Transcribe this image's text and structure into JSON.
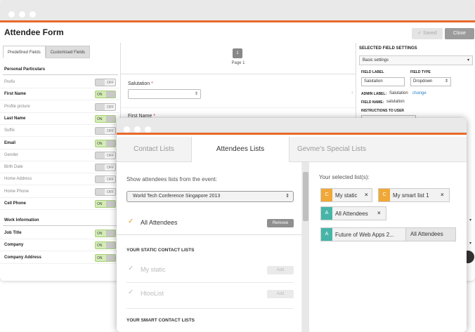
{
  "form": {
    "title": "Attendee Form",
    "saved_label": "✓ Saved",
    "close_label": "Close",
    "tabs": [
      "Predefined Fields",
      "Customised Fields"
    ],
    "section_personal": "Personal Particulars",
    "personal_fields": [
      {
        "label": "Prefix",
        "state": "OFF",
        "bold": false
      },
      {
        "label": "First Name",
        "state": "ON",
        "bold": true
      },
      {
        "label": "Profile picture",
        "state": "OFF",
        "bold": false
      },
      {
        "label": "Last Name",
        "state": "ON",
        "bold": true
      },
      {
        "label": "Suffix",
        "state": "OFF",
        "bold": false
      },
      {
        "label": "Email",
        "state": "ON",
        "bold": true
      },
      {
        "label": "Gender",
        "state": "OFF",
        "bold": false
      },
      {
        "label": "Birth Date",
        "state": "OFF",
        "bold": false
      },
      {
        "label": "Home Address",
        "state": "OFF",
        "bold": false
      },
      {
        "label": "Home Phone",
        "state": "OFF",
        "bold": false
      },
      {
        "label": "Cell Phone",
        "state": "ON",
        "bold": true
      }
    ],
    "section_work": "Work Information",
    "work_fields": [
      {
        "label": "Job Title",
        "state": "ON",
        "bold": true
      },
      {
        "label": "Company",
        "state": "ON",
        "bold": true
      },
      {
        "label": "Company Address",
        "state": "ON",
        "bold": true
      }
    ],
    "page_number": "1",
    "page_label": "Page 1",
    "salutation_label": "Salutation",
    "first_name_label": "First Name"
  },
  "settings": {
    "header": "SELECTED FIELD SETTINGS",
    "basic": "Basic settings",
    "field_label_title": "FIELD LABEL",
    "field_label_value": "Salutation",
    "field_type_title": "FIELD TYPE",
    "field_type_value": "Dropdown",
    "admin_label_title": "ADMIN LABEL:",
    "admin_label_value": "Salutation",
    "change_link": "change",
    "field_name_title": "FIELD NAME:",
    "field_name_value": "salutation",
    "instructions_title": "INSTRUCTIONS TO USER"
  },
  "lists": {
    "tabs": [
      "Contact Lists",
      "Attendees Lists",
      "Gevme's Special Lists"
    ],
    "active_tab": 1,
    "show_label": "Show attendees lists from the event:",
    "event_selected": "World Tech Conference Singapore 2013",
    "all_attendees": "All Attendees",
    "remove_label": "Remove",
    "static_head": "YOUR STATIC CONTACT LISTS",
    "static_items": [
      "My static",
      "HtooList"
    ],
    "add_label": "Add",
    "smart_head": "YOUR SMART CONTACT LISTS",
    "selected_label": "Your selected list(s):",
    "chips": [
      {
        "badge": "C",
        "label": "My static",
        "x": "×"
      },
      {
        "badge": "C",
        "label": "My smart list 1",
        "x": "×"
      },
      {
        "badge": "A",
        "label": "All Attendees",
        "x": "×"
      },
      {
        "badge": "A",
        "label": "Future of Web Apps 2...",
        "sub": "All Attendees"
      }
    ]
  },
  "colors": {
    "accent": "#e8692a",
    "on_toggle": "#d3ecb4",
    "badge_c": "#f0a837",
    "badge_a": "#46b5a8"
  }
}
